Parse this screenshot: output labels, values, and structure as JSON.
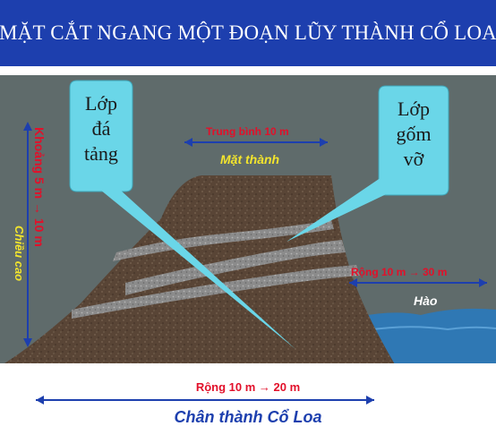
{
  "title": "MẶT CẮT NGANG MỘT ĐOẠN LŨY THÀNH CỔ LOA",
  "callouts": {
    "da_tang": [
      "Lớp",
      "đá",
      "tảng"
    ],
    "gom_vo": [
      "Lớp",
      "gốm",
      "vỡ"
    ]
  },
  "labels": {
    "top_width": "Trung bình 10 m",
    "mat_thanh": "Mặt thành",
    "height_range": "Khoảng 5 m → 10 m",
    "chieu_cao": "Chiều cao",
    "moat_width": "Rộng 10 m → 30 m",
    "hao": "Hào",
    "base_width": "Rộng 10 m → 20 m",
    "chan_thanh": "Chân thành Cổ Loa"
  },
  "colors": {
    "title_bg": "#1d3fae",
    "sky": "#5f6b6b",
    "earth": "#5a4637",
    "gravel_layer": "#8a8a8a",
    "callout_fill": "#6ad6e8",
    "water": "#2f78b4",
    "red_text": "#e2102a",
    "yellow_text": "#f3e52d",
    "blue_text": "#1d3fae"
  }
}
